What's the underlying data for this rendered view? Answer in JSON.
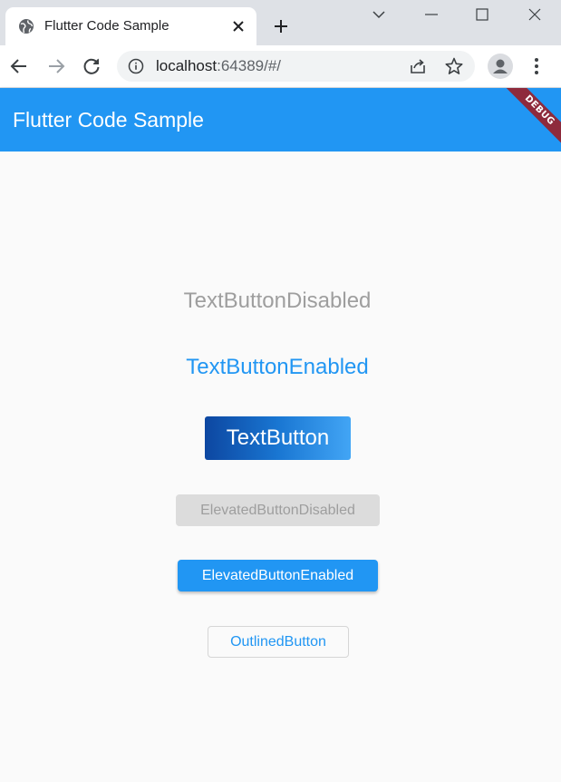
{
  "browser": {
    "tab": {
      "title": "Flutter Code Sample",
      "favicon": "globe-icon",
      "close_icon": "close-icon"
    },
    "new_tab_icon": "plus-icon",
    "window_controls": [
      "chevron-down-icon",
      "minimize-icon",
      "maximize-icon",
      "close-icon"
    ],
    "toolbar": {
      "back_icon": "back-arrow-icon",
      "forward_icon": "forward-arrow-icon",
      "reload_icon": "reload-icon",
      "info_icon": "info-icon",
      "url_host": "localhost",
      "url_rest": ":64389/#/",
      "share_icon": "share-icon",
      "bookmark_icon": "star-icon",
      "profile_icon": "profile-icon",
      "menu_icon": "kebab-menu-icon"
    }
  },
  "app": {
    "title": "Flutter Code Sample",
    "debug_banner": "DEBUG",
    "colors": {
      "primary": "#2196f3",
      "disabled_text": "#9e9e9e",
      "disabled_bg": "#dcdcdc",
      "gradient_start": "#0d47a1",
      "gradient_mid": "#1976d2",
      "gradient_end": "#42a5f5",
      "banner": "#8e2a3c"
    },
    "buttons": {
      "text_disabled": "TextButtonDisabled",
      "text_enabled": "TextButtonEnabled",
      "gradient_text": "TextButton",
      "elevated_disabled": "ElevatedButtonDisabled",
      "elevated_enabled": "ElevatedButtonEnabled",
      "outlined": "OutlinedButton"
    }
  }
}
